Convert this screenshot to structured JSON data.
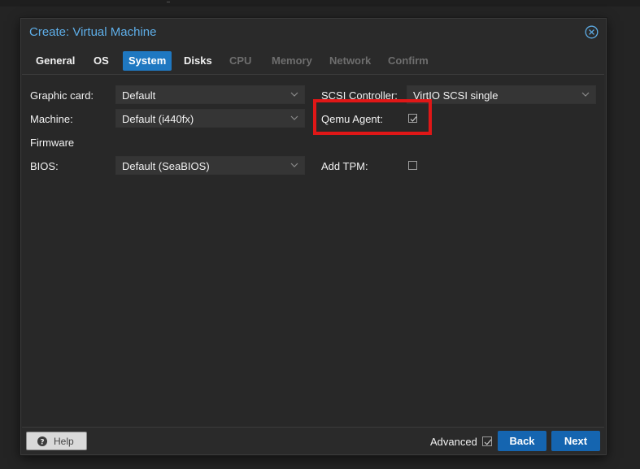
{
  "dialog": {
    "title": "Create: Virtual Machine",
    "close_icon": "close-circle-icon"
  },
  "tabs": [
    {
      "label": "General",
      "state": "enabled"
    },
    {
      "label": "OS",
      "state": "enabled"
    },
    {
      "label": "System",
      "state": "active"
    },
    {
      "label": "Disks",
      "state": "enabled"
    },
    {
      "label": "CPU",
      "state": "disabled"
    },
    {
      "label": "Memory",
      "state": "disabled"
    },
    {
      "label": "Network",
      "state": "disabled"
    },
    {
      "label": "Confirm",
      "state": "disabled"
    }
  ],
  "form": {
    "graphic_card": {
      "label": "Graphic card:",
      "value": "Default"
    },
    "machine": {
      "label": "Machine:",
      "value": "Default (i440fx)"
    },
    "firmware_section": "Firmware",
    "bios": {
      "label": "BIOS:",
      "value": "Default (SeaBIOS)"
    },
    "scsi_controller": {
      "label": "SCSI Controller:",
      "value": "VirtIO SCSI single"
    },
    "qemu_agent": {
      "label": "Qemu Agent:",
      "checked": true
    },
    "add_tpm": {
      "label": "Add TPM:",
      "checked": false
    }
  },
  "annotation": {
    "color": "#e01717"
  },
  "footer": {
    "help_label": "Help",
    "help_icon": "question-circle-icon",
    "advanced_label": "Advanced",
    "advanced_checked": true,
    "back_label": "Back",
    "next_label": "Next"
  },
  "colors": {
    "accent": "#1f78c1",
    "title": "#5eaee8",
    "button": "#1565b0",
    "background": "#2a2a2a"
  }
}
